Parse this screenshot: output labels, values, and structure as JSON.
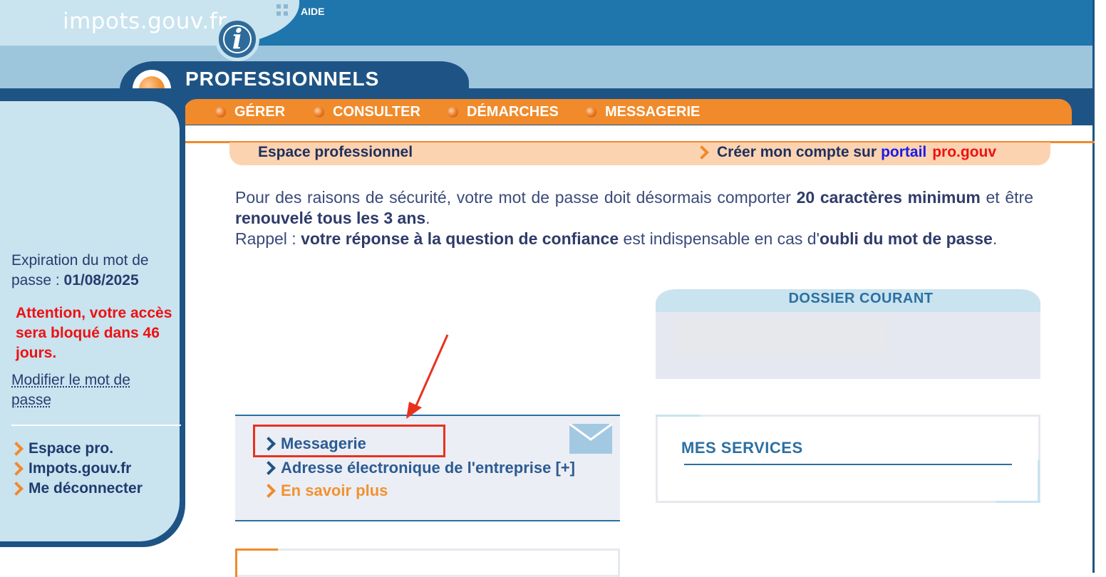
{
  "header": {
    "logo_text": "impots.gouv.fr",
    "info_icon_glyph": "i",
    "aide_label": "AIDE",
    "section_title": "PROFESSIONNELS"
  },
  "nav": {
    "items": [
      {
        "label": "GÉRER"
      },
      {
        "label": "CONSULTER"
      },
      {
        "label": "DÉMARCHES"
      },
      {
        "label": "MESSAGERIE"
      }
    ]
  },
  "sidebar": {
    "expiry_label": "Expiration du mot de passe : ",
    "expiry_date": "01/08/2025",
    "warning": "Attention, votre accès sera bloqué dans 46 jours.",
    "modify_password": "Modifier le mot de passe",
    "links": [
      {
        "label": "Espace pro."
      },
      {
        "label": "Impots.gouv.fr"
      },
      {
        "label": "Me déconnecter"
      }
    ]
  },
  "main": {
    "espace_title": "Espace professionnel",
    "create_account_prefix": "Créer mon compte sur",
    "create_account_portail": "portail",
    "create_account_progouv": "pro.gouv",
    "security": {
      "p1_a": "Pour des raisons de sécurité, votre mot de passe doit désormais comporter ",
      "p1_b": "20 caractères minimum",
      "p1_c": " et être ",
      "p1_d": "renouvelé tous les 3 ans",
      "p1_e": ".",
      "p2_a": "Rappel : ",
      "p2_b": "votre réponse à la question de confiance",
      "p2_c": " est indispensable en cas d'",
      "p2_d": "oubli du mot de passe",
      "p2_e": "."
    },
    "dossier_title": "DOSSIER COURANT",
    "messagerie_links": [
      {
        "label": "Messagerie"
      },
      {
        "label": "Adresse électronique de l'entreprise [+]"
      },
      {
        "label": "En savoir plus"
      }
    ],
    "services_title": "MES SERVICES"
  },
  "colors": {
    "dark_blue": "#1e5485",
    "header_blue": "#1f76ad",
    "light_blue": "#c9e3ef",
    "orange": "#f18a2a",
    "alert_red": "#ee1111",
    "highlight_red": "#e8321e"
  },
  "icons": [
    "info-icon",
    "pro-orb-icon",
    "nav-bullet-icon",
    "chevron-right-icon",
    "envelope-icon",
    "annotation-arrow"
  ]
}
